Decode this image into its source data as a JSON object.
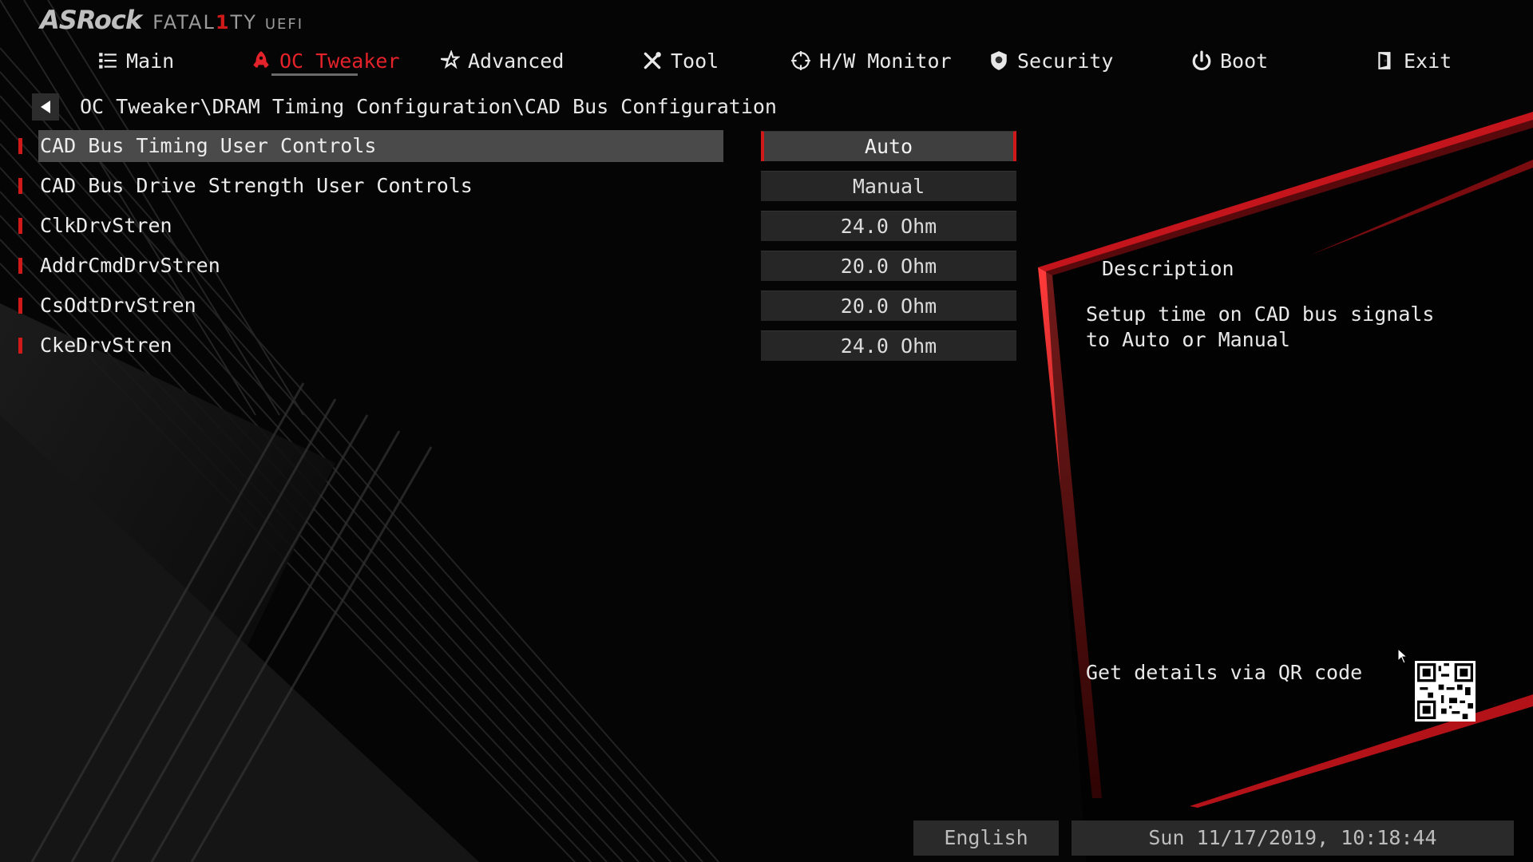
{
  "brand": {
    "name": "ASRock",
    "series_prefix": "FATAL",
    "series_one": "1",
    "series_suffix": "TY",
    "product": "UEFI"
  },
  "nav": {
    "items": [
      {
        "label": "Main",
        "icon": "list-icon"
      },
      {
        "label": "OC Tweaker",
        "icon": "rocket-icon",
        "active": true
      },
      {
        "label": "Advanced",
        "icon": "star-icon"
      },
      {
        "label": "Tool",
        "icon": "tools-icon"
      },
      {
        "label": "H/W Monitor",
        "icon": "crosshair-icon"
      },
      {
        "label": "Security",
        "icon": "shield-icon"
      },
      {
        "label": "Boot",
        "icon": "power-icon"
      },
      {
        "label": "Exit",
        "icon": "exit-door-icon"
      }
    ]
  },
  "breadcrumb": "OC Tweaker\\DRAM Timing Configuration\\CAD Bus Configuration",
  "settings": [
    {
      "label": "CAD Bus Timing User Controls",
      "value": "Auto",
      "selected": true
    },
    {
      "label": "CAD Bus Drive Strength User Controls",
      "value": "Manual"
    },
    {
      "label": "ClkDrvStren",
      "value": "24.0 Ohm"
    },
    {
      "label": "AddrCmdDrvStren",
      "value": "20.0 Ohm"
    },
    {
      "label": "CsOdtDrvStren",
      "value": "20.0 Ohm"
    },
    {
      "label": "CkeDrvStren",
      "value": "24.0 Ohm"
    }
  ],
  "description": {
    "title": "Description",
    "text": "Setup time on CAD bus signals to Auto or Manual",
    "qr_label": "Get details via QR code"
  },
  "footer": {
    "language": "English",
    "datetime": "Sun 11/17/2019, 10:18:44"
  },
  "colors": {
    "accent": "#e4222a",
    "background": "#050505",
    "highlight": "#4a4a4a"
  }
}
